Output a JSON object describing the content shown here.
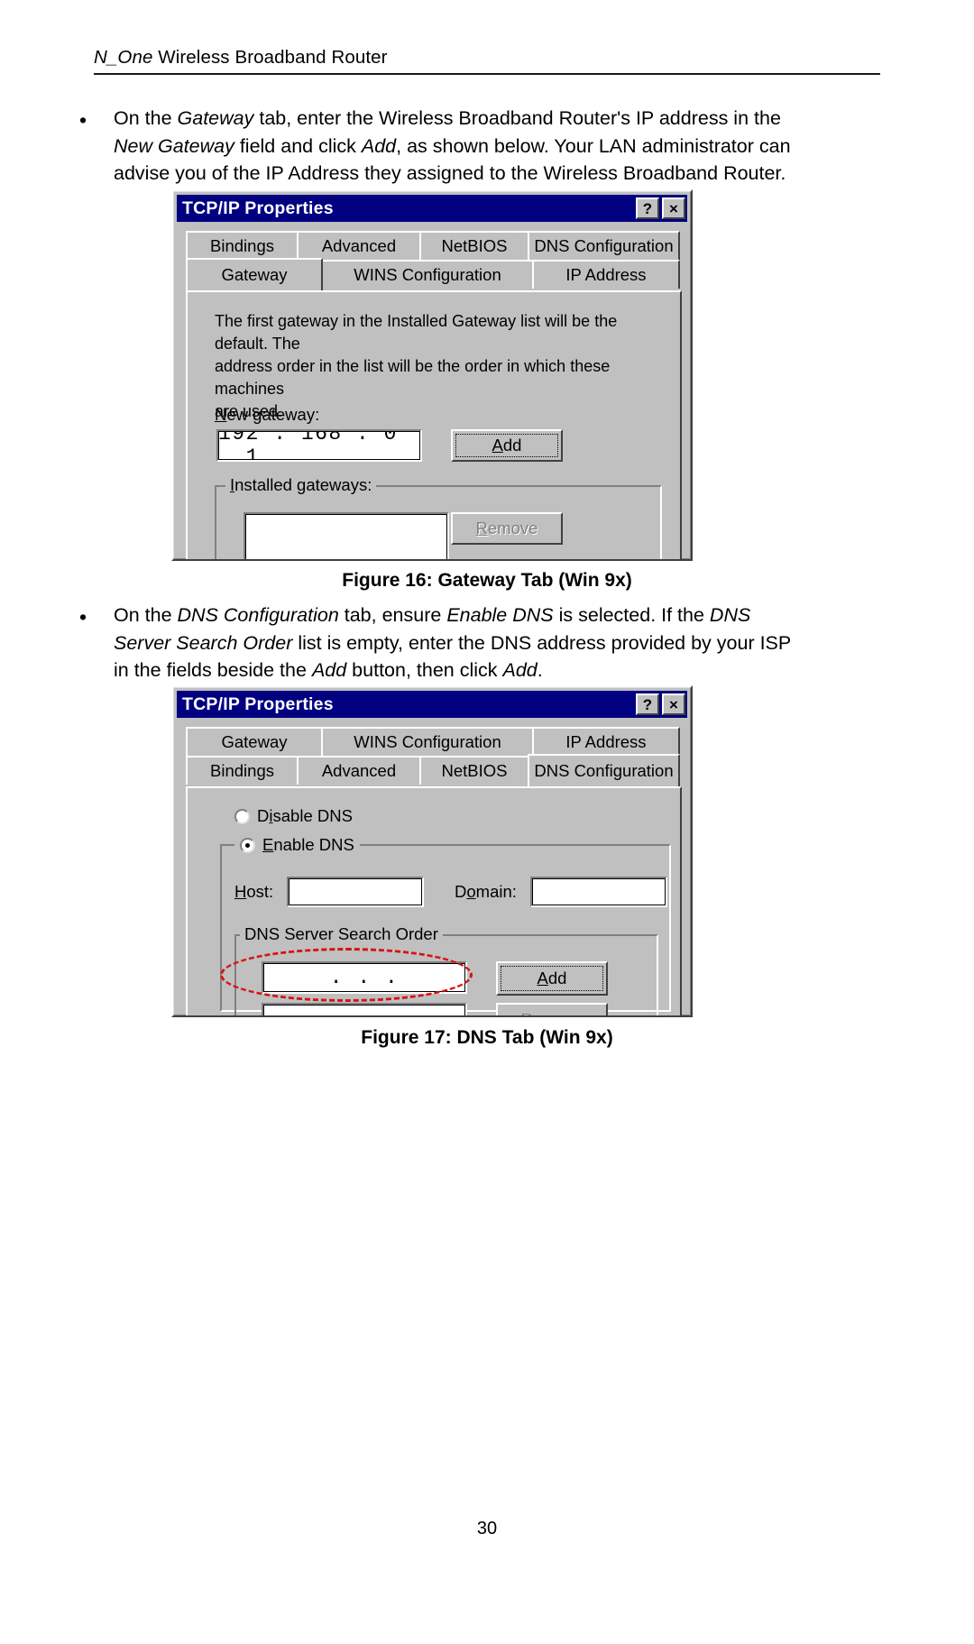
{
  "document": {
    "header_title_italic": "N_One",
    "header_title_rest": " Wireless Broadband Router",
    "page_number": "30"
  },
  "bullets": {
    "gateway": {
      "marker": "•",
      "segments": [
        {
          "text": "On the ",
          "italic": false
        },
        {
          "text": "Gateway",
          "italic": true
        },
        {
          "text": " tab, enter the Wireless Broadband Router's IP address in the ",
          "italic": false
        },
        {
          "text": "New Gateway",
          "italic": true
        },
        {
          "text": " field and click ",
          "italic": false
        },
        {
          "text": "Add",
          "italic": true
        },
        {
          "text": ", as shown below. Your LAN administrator can advise you of the IP Address they assigned to the Wireless Broadband Router.",
          "italic": false
        }
      ]
    },
    "dns": {
      "marker": "•",
      "segments": [
        {
          "text": "On the ",
          "italic": false
        },
        {
          "text": "DNS Configuration",
          "italic": true
        },
        {
          "text": " tab, ensure ",
          "italic": false
        },
        {
          "text": "Enable DNS",
          "italic": true
        },
        {
          "text": " is selected. If the ",
          "italic": false
        },
        {
          "text": "DNS Server Search Order",
          "italic": true
        },
        {
          "text": " list is empty, enter the DNS address provided by your ISP in the fields beside the ",
          "italic": false
        },
        {
          "text": "Add",
          "italic": true
        },
        {
          "text": " button, then click ",
          "italic": false
        },
        {
          "text": "Add",
          "italic": true
        },
        {
          "text": ".",
          "italic": false
        }
      ]
    }
  },
  "captions": {
    "figure16": "Figure 16: Gateway Tab (Win 9x)",
    "figure17": "Figure 17: DNS Tab (Win 9x)"
  },
  "dialog_gateway": {
    "title": "TCP/IP Properties",
    "titlebar_buttons": [
      {
        "name": "help-button",
        "glyph": "?"
      },
      {
        "name": "close-button",
        "glyph": "×"
      }
    ],
    "tabs_row_top": [
      "Bindings",
      "Advanced",
      "NetBIOS",
      "DNS Configuration"
    ],
    "tabs_row_bottom": [
      "Gateway",
      "WINS Configuration",
      "IP Address"
    ],
    "active_tab": "Gateway",
    "description": "The first gateway in the Installed Gateway list will be the default. The\naddress order in the list will be the order in which these machines\nare used.",
    "new_gateway_label": "New gateway:",
    "new_gateway_label_accel": "N",
    "new_gateway_value": "192 . 168 .   0   .   1",
    "add_button": "Add",
    "add_button_accel": "A",
    "installed_gateways_label": "Installed gateways:",
    "installed_gateways_accel": "I",
    "installed_gateways_items": [],
    "remove_button": "Remove",
    "remove_button_accel": "R",
    "remove_button_enabled": false
  },
  "dialog_dns": {
    "title": "TCP/IP Properties",
    "titlebar_buttons": [
      {
        "name": "help-button",
        "glyph": "?"
      },
      {
        "name": "close-button",
        "glyph": "×"
      }
    ],
    "tabs_row_top": [
      "Gateway",
      "WINS Configuration",
      "IP Address"
    ],
    "tabs_row_bottom": [
      "Bindings",
      "Advanced",
      "NetBIOS",
      "DNS Configuration"
    ],
    "active_tab": "DNS Configuration",
    "radio_disable_dns": "Disable DNS",
    "radio_disable_dns_accel": "i",
    "radio_enable_dns": "Enable DNS",
    "radio_enable_dns_accel": "E",
    "selected_radio": "Enable DNS",
    "host_label": "Host:",
    "host_label_accel": "H",
    "host_value": "",
    "domain_label": "Domain:",
    "domain_label_accel": "o",
    "domain_value": "",
    "search_order_label": "DNS Server Search Order",
    "search_order_value": ".     .     .",
    "search_order_items": [],
    "add_button": "Add",
    "add_button_accel": "A",
    "remove_button": "Remove",
    "remove_button_accel": "R",
    "remove_button_enabled": false
  },
  "annotations": {
    "highlight_color": "#d81212",
    "highlight_target": "dns-search-order-input"
  }
}
